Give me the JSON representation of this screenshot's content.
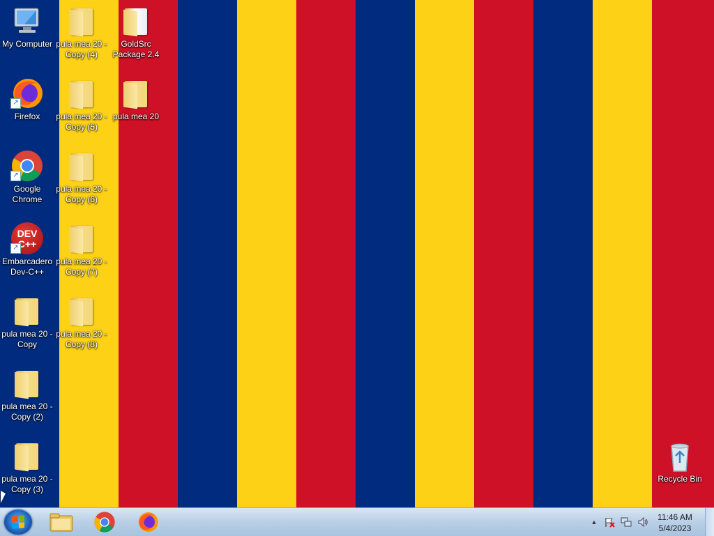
{
  "wallpaper": {
    "stripe_colors": [
      "#002b7f",
      "#fcd116",
      "#ce1126",
      "#002b7f",
      "#fcd116",
      "#ce1126",
      "#002b7f",
      "#fcd116",
      "#ce1126",
      "#002b7f",
      "#fcd116",
      "#ce1126"
    ]
  },
  "desktop_icons": [
    {
      "name": "my-computer",
      "label": "My Computer",
      "icon": "computer-icon"
    },
    {
      "name": "firefox",
      "label": "Firefox",
      "icon": "firefox-icon",
      "shortcut": true
    },
    {
      "name": "google-chrome",
      "label": "Google Chrome",
      "icon": "chrome-icon",
      "shortcut": true
    },
    {
      "name": "embarcadero-dev-cpp",
      "label": "Embarcadero Dev-C++",
      "icon": "devcpp-icon",
      "shortcut": true,
      "icon_text": "DEV C++"
    },
    {
      "name": "folder-copy",
      "label": "pula mea 20 - Copy",
      "icon": "folder-icon"
    },
    {
      "name": "folder-copy-2",
      "label": "pula mea 20 - Copy (2)",
      "icon": "folder-icon"
    },
    {
      "name": "folder-copy-3",
      "label": "pula mea 20 - Copy (3)",
      "icon": "folder-icon"
    },
    {
      "name": "folder-copy-4",
      "label": "pula mea 20 - Copy (4)",
      "icon": "folder-icon"
    },
    {
      "name": "folder-copy-5",
      "label": "pula mea 20 - Copy (5)",
      "icon": "folder-icon"
    },
    {
      "name": "folder-copy-6",
      "label": "pula mea 20 - Copy (6)",
      "icon": "folder-icon"
    },
    {
      "name": "folder-copy-7",
      "label": "pula mea 20 - Copy (7)",
      "icon": "folder-icon"
    },
    {
      "name": "folder-copy-8",
      "label": "pula mea 20 - Copy (8)",
      "icon": "folder-icon"
    },
    {
      "name": "goldsrc-package",
      "label": "GoldSrc Package 2.4",
      "icon": "folder-icon"
    },
    {
      "name": "folder-pula-mea-20",
      "label": "pula mea 20",
      "icon": "folder-icon"
    },
    {
      "name": "recycle-bin",
      "label": "Recycle Bin",
      "icon": "recycle-bin-icon"
    }
  ],
  "taskbar": {
    "pinned": [
      {
        "name": "file-explorer",
        "icon": "folder-icon"
      },
      {
        "name": "chrome",
        "icon": "chrome-icon"
      },
      {
        "name": "firefox",
        "icon": "firefox-icon"
      }
    ],
    "tray_icons": [
      "show-hidden-icons-arrow-icon",
      "action-center-flag-icon",
      "network-icon",
      "volume-icon"
    ],
    "clock": {
      "time": "11:46 AM",
      "date": "5/4/2023"
    }
  }
}
